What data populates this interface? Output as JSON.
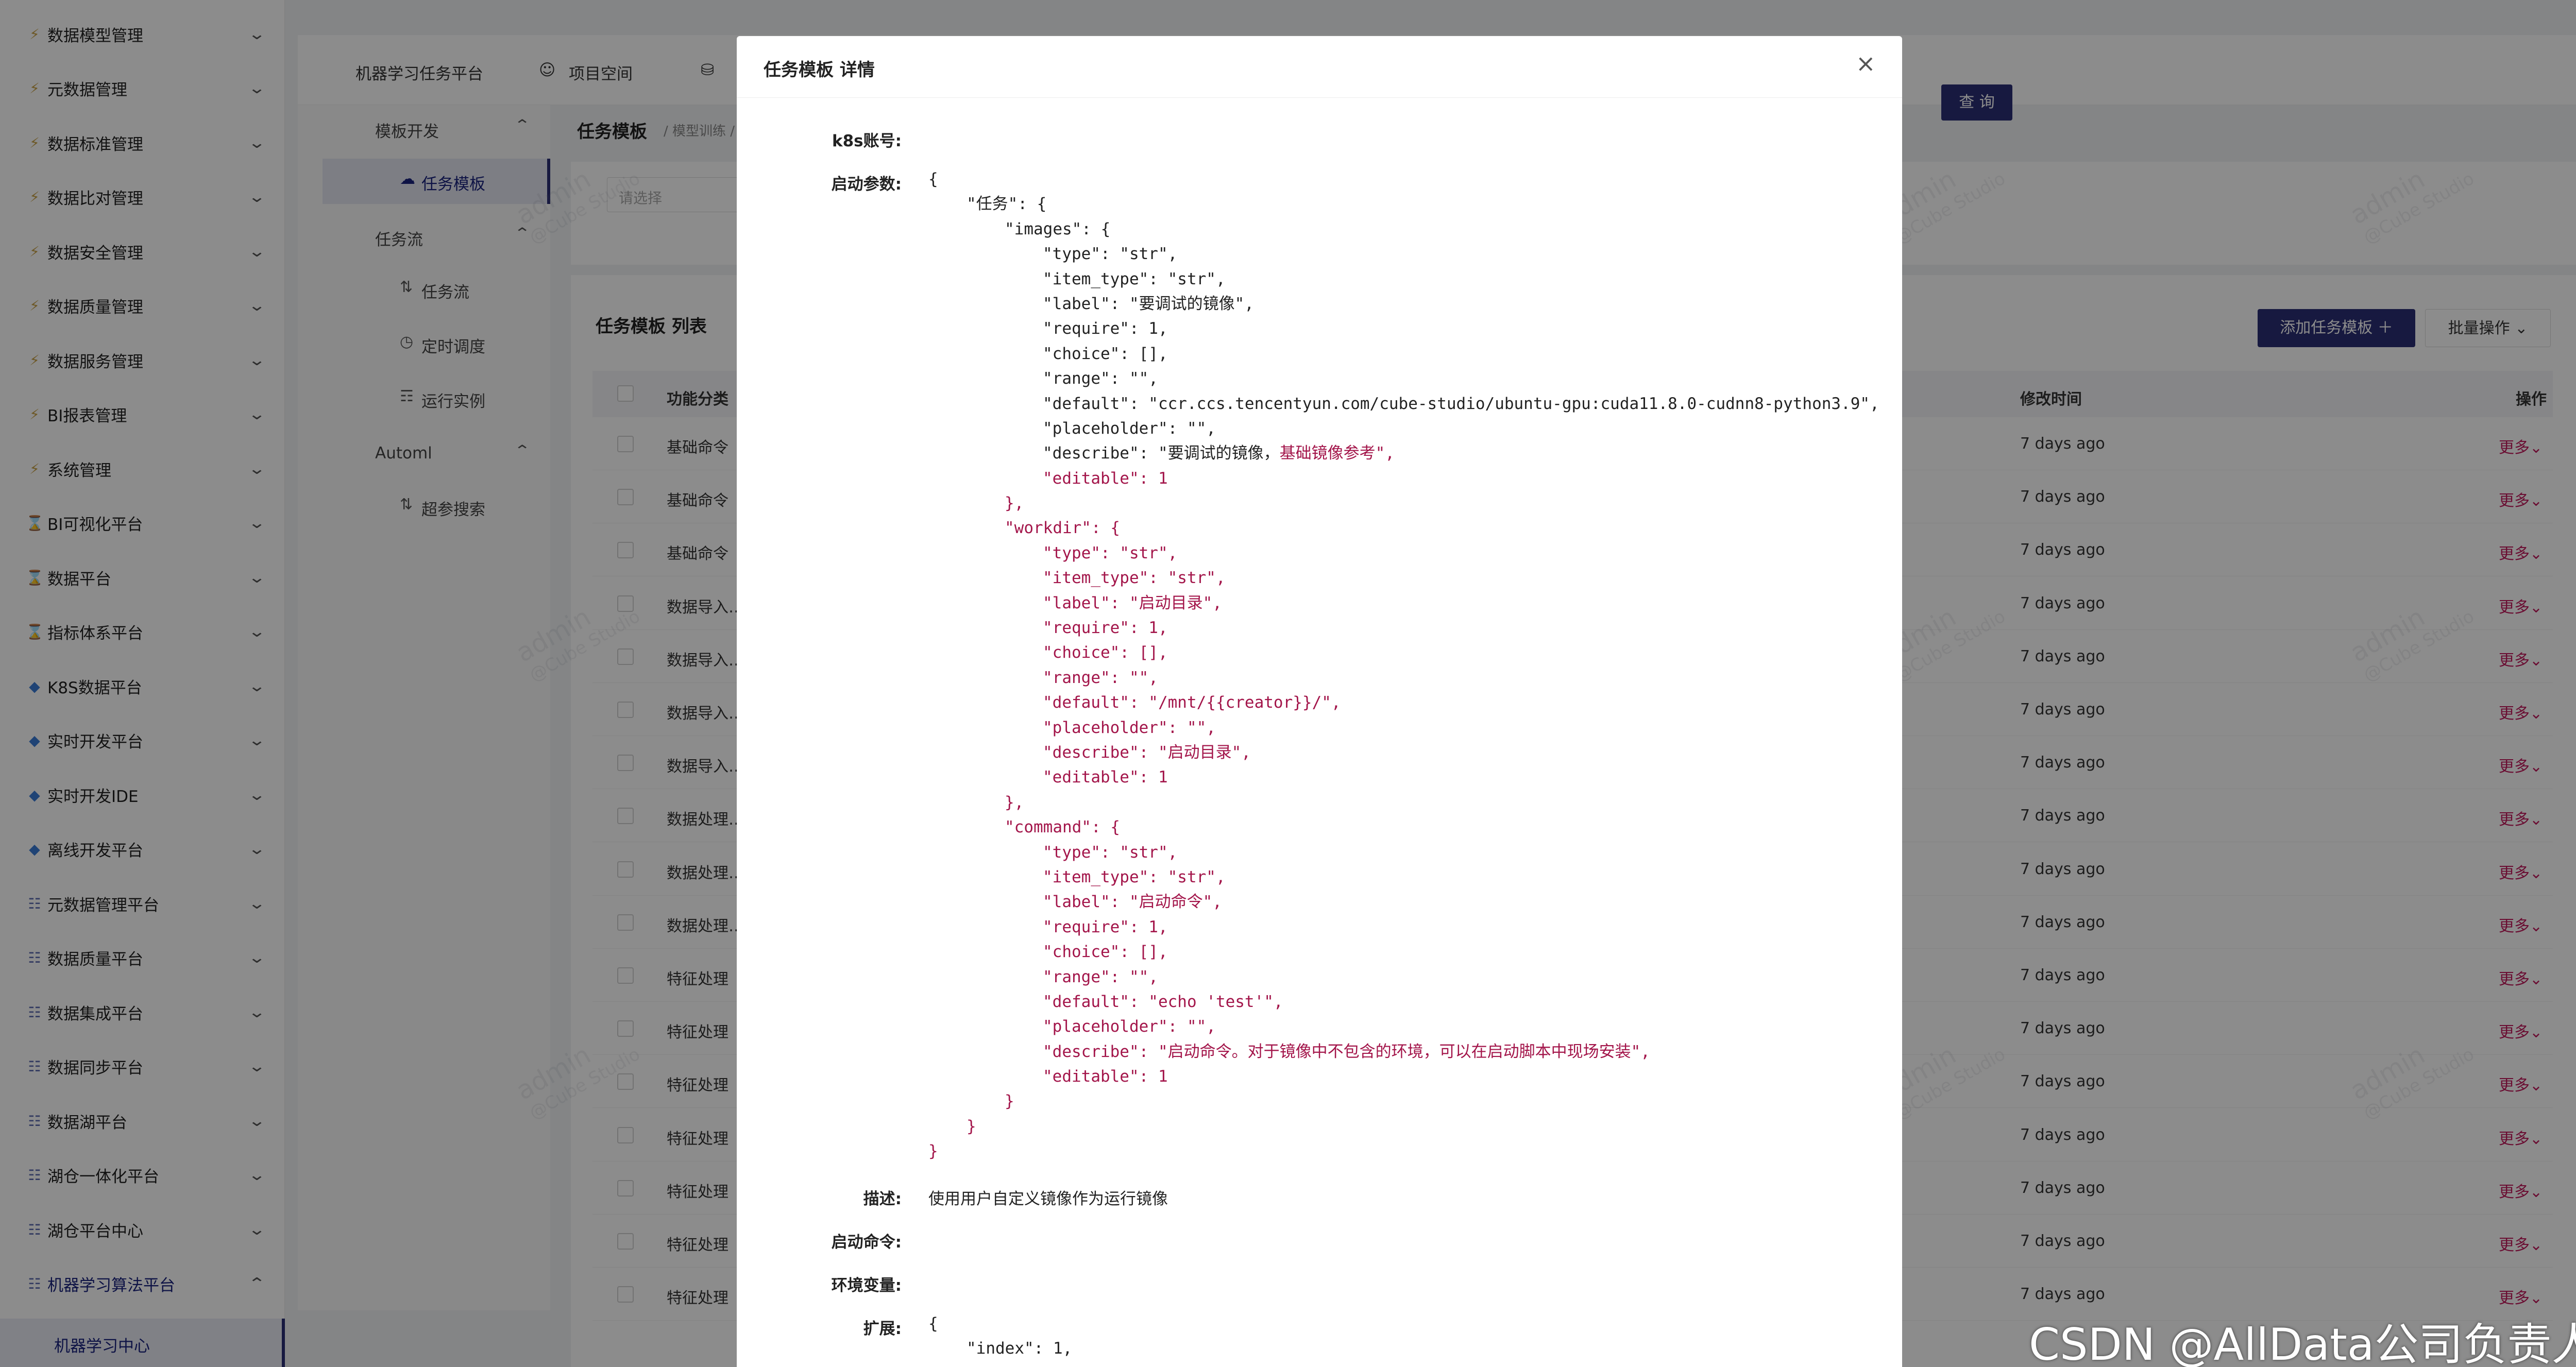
{
  "sidebar": {
    "items": [
      {
        "icon": "⚡",
        "label": "数据模型管理"
      },
      {
        "icon": "⚡",
        "label": "元数据管理"
      },
      {
        "icon": "⚡",
        "label": "数据标准管理"
      },
      {
        "icon": "⚡",
        "label": "数据比对管理"
      },
      {
        "icon": "⚡",
        "label": "数据安全管理"
      },
      {
        "icon": "⚡",
        "label": "数据质量管理"
      },
      {
        "icon": "⚡",
        "label": "数据服务管理"
      },
      {
        "icon": "⚡",
        "label": "BI报表管理"
      },
      {
        "icon": "⚡",
        "label": "系统管理"
      },
      {
        "icon": "⌛",
        "label": "BI可视化平台"
      },
      {
        "icon": "⌛",
        "label": "数据平台"
      },
      {
        "icon": "⌛",
        "label": "指标体系平台"
      },
      {
        "icon": "◆",
        "label": "K8S数据平台"
      },
      {
        "icon": "◆",
        "label": "实时开发平台"
      },
      {
        "icon": "◆",
        "label": "实时开发IDE"
      },
      {
        "icon": "◆",
        "label": "离线开发平台"
      },
      {
        "icon": "☷",
        "label": "元数据管理平台"
      },
      {
        "icon": "☷",
        "label": "数据质量平台"
      },
      {
        "icon": "☷",
        "label": "数据集成平台"
      },
      {
        "icon": "☷",
        "label": "数据同步平台"
      },
      {
        "icon": "☷",
        "label": "数据湖平台"
      },
      {
        "icon": "☷",
        "label": "湖仓一体化平台"
      },
      {
        "icon": "☷",
        "label": "湖仓平台中心"
      },
      {
        "icon": "☷",
        "label": "机器学习算法平台"
      }
    ],
    "active_child": "机器学习中心"
  },
  "header": {
    "tabs": [
      "机器学习任务平台",
      "项目空间"
    ]
  },
  "subnav": {
    "groups": [
      {
        "label": "模板开发",
        "children": [
          {
            "icon": "☁",
            "label": "任务模板",
            "active": true
          }
        ]
      },
      {
        "label": "任务流",
        "children": [
          {
            "icon": "⇅",
            "label": "任务流"
          },
          {
            "icon": "◷",
            "label": "定时调度"
          },
          {
            "icon": "☶",
            "label": "运行实例"
          }
        ]
      },
      {
        "label": "Automl",
        "children": [
          {
            "icon": "⇅",
            "label": "超参搜索"
          }
        ]
      }
    ]
  },
  "main": {
    "title": "任务模板",
    "breadcrumb": "/ 模型训练 /",
    "select_placeholder": "请选择",
    "query_label": "查 询",
    "list_title": "任务模板 列表",
    "add_label": "添加任务模板 ＋",
    "batch_label": "批量操作 ⌄",
    "columns": {
      "category": "功能分类",
      "modified": "修改时间",
      "actions": "操作"
    },
    "rows": [
      {
        "category": "基础命令",
        "modified": "7 days ago",
        "action": "更多⌄"
      },
      {
        "category": "基础命令",
        "modified": "7 days ago",
        "action": "更多⌄"
      },
      {
        "category": "基础命令",
        "modified": "7 days ago",
        "action": "更多⌄"
      },
      {
        "category": "数据导入…",
        "modified": "7 days ago",
        "action": "更多⌄"
      },
      {
        "category": "数据导入…",
        "modified": "7 days ago",
        "action": "更多⌄"
      },
      {
        "category": "数据导入…",
        "modified": "7 days ago",
        "action": "更多⌄"
      },
      {
        "category": "数据导入…",
        "modified": "7 days ago",
        "action": "更多⌄"
      },
      {
        "category": "数据处理…",
        "modified": "7 days ago",
        "action": "更多⌄"
      },
      {
        "category": "数据处理…",
        "modified": "7 days ago",
        "action": "更多⌄"
      },
      {
        "category": "数据处理…",
        "modified": "7 days ago",
        "action": "更多⌄"
      },
      {
        "category": "特征处理",
        "modified": "7 days ago",
        "action": "更多⌄"
      },
      {
        "category": "特征处理",
        "modified": "7 days ago",
        "action": "更多⌄"
      },
      {
        "category": "特征处理",
        "modified": "7 days ago",
        "action": "更多⌄"
      },
      {
        "category": "特征处理",
        "modified": "7 days ago",
        "action": "更多⌄"
      },
      {
        "category": "特征处理",
        "modified": "7 days ago",
        "action": "更多⌄"
      },
      {
        "category": "特征处理",
        "modified": "7 days ago",
        "action": "更多⌄"
      },
      {
        "category": "特征处理",
        "modified": "7 days ago",
        "action": "更多⌄"
      }
    ]
  },
  "modal": {
    "title": "任务模板 详情",
    "close": "×",
    "labels": {
      "k8s": "k8s账号:",
      "params": "启动参数:",
      "desc": "描述:",
      "command": "启动命令:",
      "env": "环境变量:",
      "ext": "扩展:"
    },
    "description": "使用用户自定义镜像作为运行镜像",
    "json_lines": [
      {
        "i": 0,
        "t": "{",
        "c": "k"
      },
      {
        "i": 1,
        "t": "\"任务\": {",
        "c": "k"
      },
      {
        "i": 2,
        "t": "\"images\": {",
        "c": "k"
      },
      {
        "i": 3,
        "t": "\"type\": \"str\",",
        "c": "k"
      },
      {
        "i": 3,
        "t": "\"item_type\": \"str\",",
        "c": "k"
      },
      {
        "i": 3,
        "t": "\"label\": \"要调试的镜像\",",
        "c": "k"
      },
      {
        "i": 3,
        "t": "\"require\": 1,",
        "c": "k"
      },
      {
        "i": 3,
        "t": "\"choice\": [],",
        "c": "k"
      },
      {
        "i": 3,
        "t": "\"range\": \"\",",
        "c": "k"
      },
      {
        "i": 3,
        "t": "\"default\": \"ccr.ccs.tencentyun.com/cube-studio/ubuntu-gpu:cuda11.8.0-cudnn8-python3.9\",",
        "c": "k"
      },
      {
        "i": 3,
        "t": "\"placeholder\": \"\",",
        "c": "k"
      },
      {
        "i": 3,
        "t": "\"describe\": \"要调试的镜像，",
        "c": "k",
        "tail": "基础镜像参考\","
      },
      {
        "i": 3,
        "t": "\"editable\": 1",
        "c": "r"
      },
      {
        "i": 2,
        "t": "},",
        "c": "r"
      },
      {
        "i": 2,
        "t": "\"workdir\": {",
        "c": "r"
      },
      {
        "i": 3,
        "t": "\"type\": \"str\",",
        "c": "r"
      },
      {
        "i": 3,
        "t": "\"item_type\": \"str\",",
        "c": "r"
      },
      {
        "i": 3,
        "t": "\"label\": \"启动目录\",",
        "c": "r"
      },
      {
        "i": 3,
        "t": "\"require\": 1,",
        "c": "r"
      },
      {
        "i": 3,
        "t": "\"choice\": [],",
        "c": "r"
      },
      {
        "i": 3,
        "t": "\"range\": \"\",",
        "c": "r"
      },
      {
        "i": 3,
        "t": "\"default\": \"/mnt/{{creator}}/\",",
        "c": "r"
      },
      {
        "i": 3,
        "t": "\"placeholder\": \"\",",
        "c": "r"
      },
      {
        "i": 3,
        "t": "\"describe\": \"启动目录\",",
        "c": "r"
      },
      {
        "i": 3,
        "t": "\"editable\": 1",
        "c": "r"
      },
      {
        "i": 2,
        "t": "},",
        "c": "r"
      },
      {
        "i": 2,
        "t": "\"command\": {",
        "c": "r"
      },
      {
        "i": 3,
        "t": "\"type\": \"str\",",
        "c": "r"
      },
      {
        "i": 3,
        "t": "\"item_type\": \"str\",",
        "c": "r"
      },
      {
        "i": 3,
        "t": "\"label\": \"启动命令\",",
        "c": "r"
      },
      {
        "i": 3,
        "t": "\"require\": 1,",
        "c": "r"
      },
      {
        "i": 3,
        "t": "\"choice\": [],",
        "c": "r"
      },
      {
        "i": 3,
        "t": "\"range\": \"\",",
        "c": "r"
      },
      {
        "i": 3,
        "t": "\"default\": \"echo 'test'\",",
        "c": "r"
      },
      {
        "i": 3,
        "t": "\"placeholder\": \"\",",
        "c": "r"
      },
      {
        "i": 3,
        "t": "\"describe\": \"启动命令。对于镜像中不包含的环境，可以在启动脚本中现场安装\",",
        "c": "r"
      },
      {
        "i": 3,
        "t": "\"editable\": 1",
        "c": "r"
      },
      {
        "i": 2,
        "t": "}",
        "c": "r"
      },
      {
        "i": 1,
        "t": "}",
        "c": "r"
      },
      {
        "i": 0,
        "t": "}",
        "c": "r"
      }
    ],
    "ext_lines": [
      {
        "i": 0,
        "t": "{",
        "c": "k"
      },
      {
        "i": 1,
        "t": "\"index\": 1,",
        "c": "k"
      }
    ]
  },
  "watermark": {
    "line1": "admin",
    "line2": "@Cube Studio"
  },
  "csdn": "CSDN @AllData公司负责人",
  "colors": {
    "brand": "#2b2f75",
    "action": "#c2185b",
    "json_value": "#a3154a"
  }
}
